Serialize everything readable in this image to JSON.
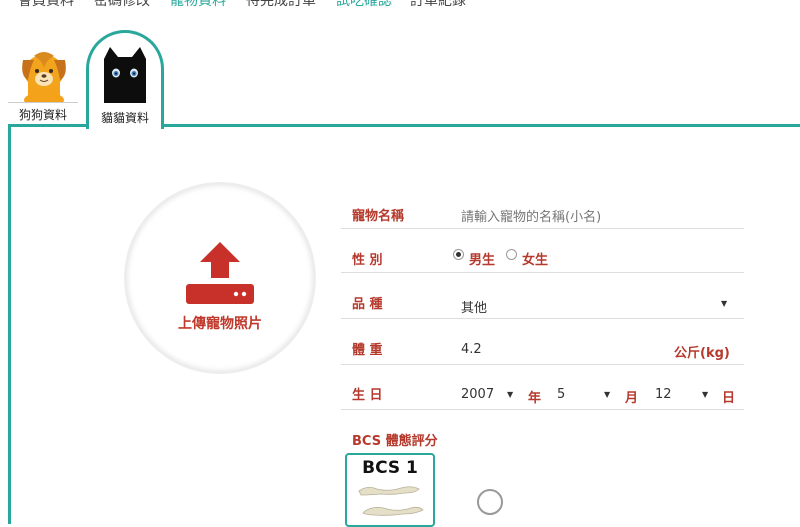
{
  "top_nav": {
    "items": [
      "會員資料",
      "密碼修改",
      "寵物資料",
      "待完成訂單",
      "試吃確認",
      "訂單紀錄"
    ],
    "active_index": 2,
    "accent_color": "#2aa79b"
  },
  "pet_tabs": [
    {
      "label": "狗狗資料",
      "icon": "dog-icon",
      "active": false
    },
    {
      "label": "貓貓資料",
      "icon": "cat-icon",
      "active": true
    }
  ],
  "upload": {
    "label": "上傳寵物照片",
    "icon": "upload-icon"
  },
  "form": {
    "name": {
      "label": "寵物名稱",
      "placeholder": "請輸入寵物的名稱(小名)"
    },
    "gender": {
      "label": "性 別",
      "options": [
        "男生",
        "女生"
      ],
      "selected": "男生"
    },
    "breed": {
      "label": "品 種",
      "value": "其他"
    },
    "weight": {
      "label": "體 重",
      "value": "4.2",
      "unit": "公斤(kg)"
    },
    "birthday": {
      "label": "生 日",
      "year": "2007",
      "year_unit": "年",
      "month": "5",
      "month_unit": "月",
      "day": "12",
      "day_unit": "日"
    },
    "bcs": {
      "label": "BCS 體態評分",
      "card_title": "BCS 1"
    }
  },
  "colors": {
    "accent": "#2aa79b",
    "label_red": "#b5392c",
    "upload_red": "#c0392b"
  }
}
